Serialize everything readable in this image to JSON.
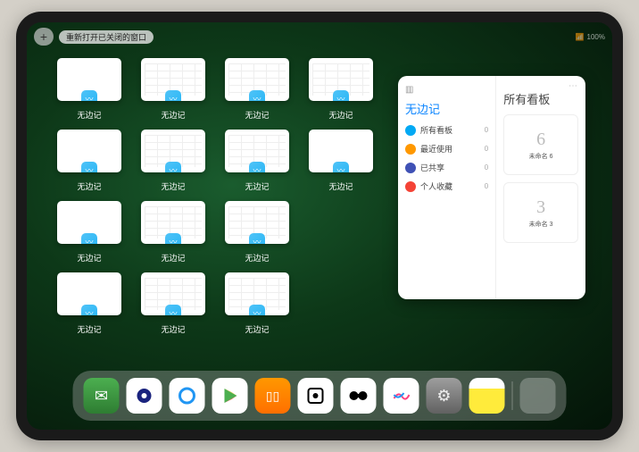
{
  "status": {
    "battery": "100%",
    "wifi": "📶"
  },
  "topbar": {
    "plus": "+",
    "reopen": "重新打开已关闭的窗口"
  },
  "app_name": "无边记",
  "grid_rows": [
    4,
    4,
    3,
    3
  ],
  "thumb_variant": [
    "plain",
    "grid",
    "grid",
    "grid",
    "plain",
    "grid",
    "grid",
    "",
    "plain",
    "grid",
    "grid",
    "",
    "plain",
    "grid",
    "grid"
  ],
  "panel": {
    "title_left": "无边记",
    "title_right": "所有看板",
    "dots": "⋯",
    "categories": [
      {
        "label": "所有看板",
        "count": 0,
        "color": "#03a9f4"
      },
      {
        "label": "最近使用",
        "count": 0,
        "color": "#ff9800"
      },
      {
        "label": "已共享",
        "count": 0,
        "color": "#3f51b5"
      },
      {
        "label": "个人收藏",
        "count": 0,
        "color": "#f44336"
      }
    ],
    "boards": [
      {
        "glyph": "6",
        "label": "未命名 6",
        "sub": ""
      },
      {
        "glyph": "3",
        "label": "未命名 3",
        "sub": ""
      }
    ]
  },
  "dock": [
    {
      "name": "wechat",
      "glyph": "💬"
    },
    {
      "name": "quark1",
      "glyph": "◉"
    },
    {
      "name": "quark2",
      "glyph": "◯"
    },
    {
      "name": "play",
      "glyph": "▶"
    },
    {
      "name": "books",
      "glyph": "▮▮"
    },
    {
      "name": "dot",
      "glyph": "⊡"
    },
    {
      "name": "barbell",
      "glyph": "⬢⬢"
    },
    {
      "name": "freeform",
      "glyph": "〰"
    },
    {
      "name": "settings",
      "glyph": "⚙"
    },
    {
      "name": "notes",
      "glyph": ""
    }
  ]
}
